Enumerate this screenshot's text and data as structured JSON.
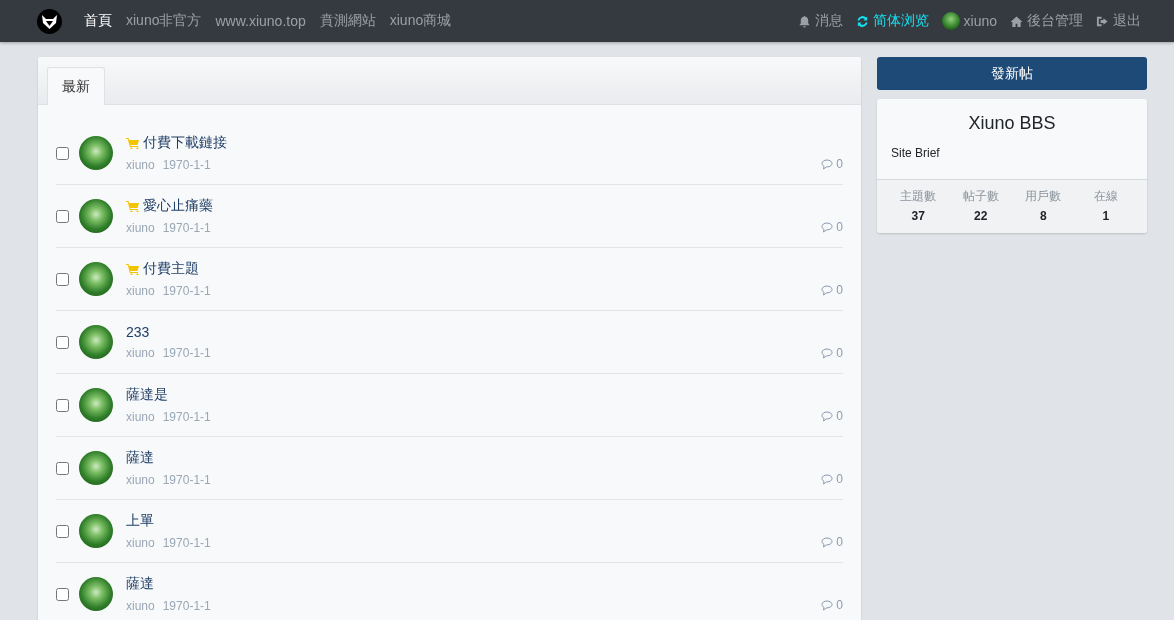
{
  "navbar": {
    "nav_left": [
      {
        "label": "首頁",
        "selected": true
      },
      {
        "label": "xiuno非官方",
        "selected": false
      },
      {
        "label": "www.xiuno.top",
        "selected": false
      },
      {
        "label": "賁測網站",
        "selected": false
      },
      {
        "label": "xiuno商城",
        "selected": false
      }
    ],
    "nav_right": [
      {
        "kind": "bell",
        "label": "消息"
      },
      {
        "kind": "lang",
        "label": "简体浏览"
      },
      {
        "kind": "user",
        "label": "xiuno"
      },
      {
        "kind": "home",
        "label": "後台管理"
      },
      {
        "kind": "logout",
        "label": "退出"
      }
    ]
  },
  "thread_list": {
    "tabs": [
      {
        "label": "最新",
        "selected": true
      }
    ],
    "threads": [
      {
        "title": "付費下載鏈接",
        "paid": true,
        "checked": false,
        "author": "xiuno",
        "date": "1970-1-1",
        "replies": "0"
      },
      {
        "title": "愛心止痛藥",
        "paid": true,
        "checked": false,
        "author": "xiuno",
        "date": "1970-1-1",
        "replies": "0"
      },
      {
        "title": "付費主題",
        "paid": true,
        "checked": false,
        "author": "xiuno",
        "date": "1970-1-1",
        "replies": "0"
      },
      {
        "title": "233",
        "paid": false,
        "checked": false,
        "author": "xiuno",
        "date": "1970-1-1",
        "replies": "0"
      },
      {
        "title": "薩達是",
        "paid": false,
        "checked": false,
        "author": "xiuno",
        "date": "1970-1-1",
        "replies": "0"
      },
      {
        "title": "薩達",
        "paid": false,
        "checked": false,
        "author": "xiuno",
        "date": "1970-1-1",
        "replies": "0"
      },
      {
        "title": "上單",
        "paid": false,
        "checked": false,
        "author": "xiuno",
        "date": "1970-1-1",
        "replies": "0"
      },
      {
        "title": "薩達",
        "paid": false,
        "checked": false,
        "author": "xiuno",
        "date": "1970-1-1",
        "replies": "0"
      }
    ]
  },
  "sidebar": {
    "new_post_button": "發新帖",
    "site_name": "Xiuno BBS",
    "site_brief": "Site Brief",
    "stats": [
      {
        "label": "主題數",
        "value": "37"
      },
      {
        "label": "帖子數",
        "value": "22"
      },
      {
        "label": "用戶數",
        "value": "8"
      },
      {
        "label": "在線",
        "value": "1"
      }
    ]
  }
}
